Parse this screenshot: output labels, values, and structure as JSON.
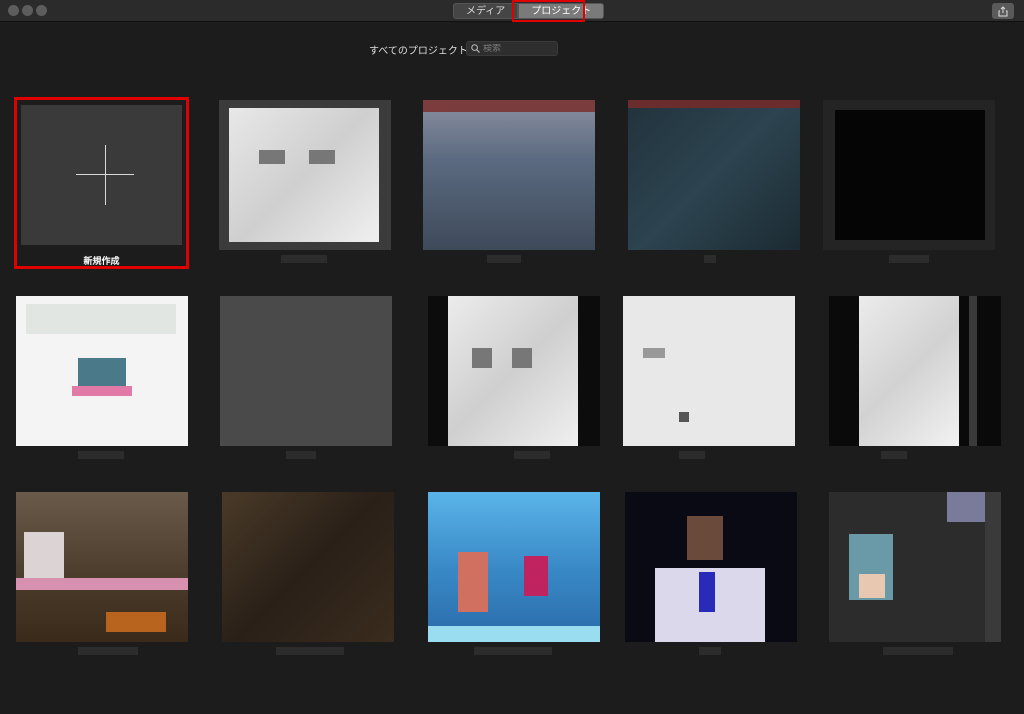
{
  "titlebar": {
    "tabs": [
      {
        "label": "メディア",
        "active": false
      },
      {
        "label": "プロジェクト",
        "active": true
      }
    ]
  },
  "toolbar": {
    "filter_label": "すべてのプロジェクト",
    "filter_chevron": "⌃⌄",
    "search_placeholder": "検索"
  },
  "projects": {
    "new_label": "新規作成",
    "items_visible": 14
  },
  "colors": {
    "highlight": "#e00000",
    "background": "#1c1c1c"
  }
}
